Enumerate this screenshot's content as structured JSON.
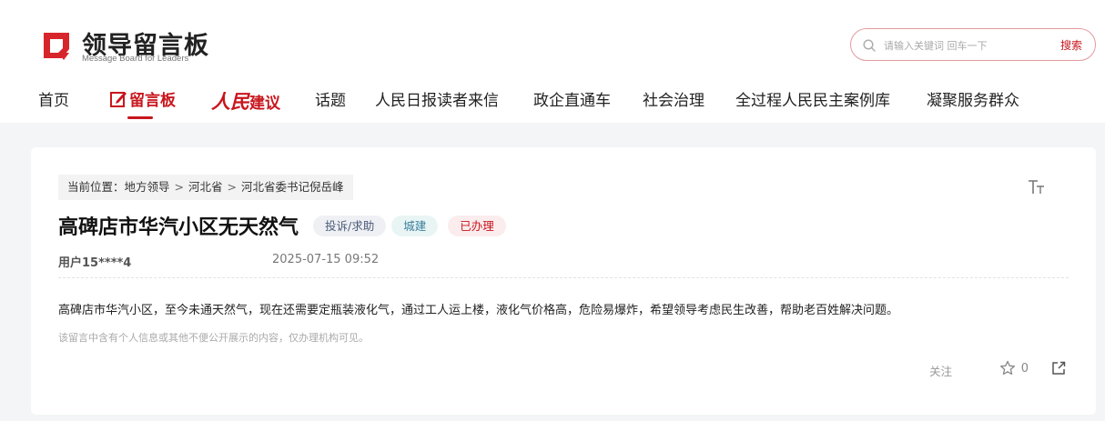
{
  "brand": {
    "title": "领导留言板",
    "subtitle": "Message Board for Leaders",
    "accent_color": "#c8161d"
  },
  "search": {
    "placeholder": "请输入关键词 回车一下",
    "button_label": "搜索"
  },
  "nav": {
    "items": [
      {
        "label": "首页"
      },
      {
        "label": "留言板",
        "active": true,
        "icon": "edit-icon"
      },
      {
        "label_prefix": "人民",
        "label": "建议"
      },
      {
        "label": "话题"
      },
      {
        "label": "人民日报读者来信"
      },
      {
        "label": "政企直通车"
      },
      {
        "label": "社会治理"
      },
      {
        "label": "全过程人民民主案例库"
      },
      {
        "label": "凝聚服务群众"
      }
    ]
  },
  "breadcrumb": {
    "prefix": "当前位置：",
    "items": [
      "地方领导",
      "河北省",
      "河北省委书记倪岳峰"
    ],
    "separator": ">"
  },
  "message": {
    "title": "高碑店市华汽小区无天然气",
    "tags": {
      "type": "投诉/求助",
      "field": "城建",
      "status": "已办理"
    },
    "user": "用户15****4",
    "date": "2025-07-15 09:52",
    "content": "高碑店市华汽小区，至今未通天然气，现在还需要定瓶装液化气，通过工人运上楼，液化气价格高，危险易爆炸，希望领导考虑民生改善，帮助老百姓解决问题。",
    "notice": "该留言中含有个人信息或其他不便公开展示的内容，仅办理机构可见。",
    "actions": {
      "follow_label": "关注",
      "star_count": "0"
    }
  }
}
